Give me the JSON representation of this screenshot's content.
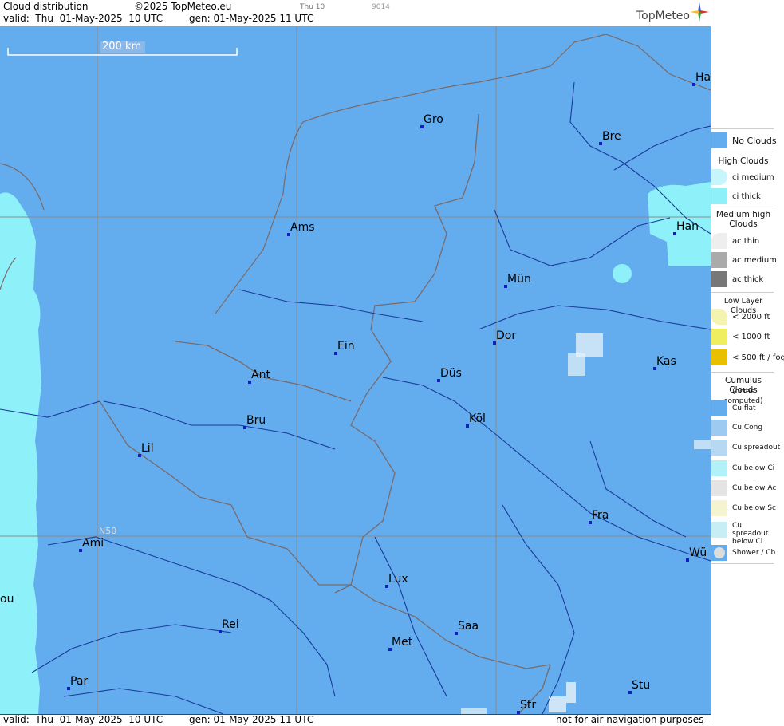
{
  "header": {
    "title": "Cloud distribution",
    "copyright": "©2025 TopMeteo.eu",
    "day_tag": "Thu 10",
    "code": "9014",
    "valid": "valid:  Thu  01-May-2025  10 UTC",
    "gen": "gen: 01-May-2025 11 UTC",
    "logo": "TopMeteo"
  },
  "footer": {
    "valid": "valid:  Thu  01-May-2025  10 UTC",
    "gen": "gen: 01-May-2025 11 UTC",
    "disclaimer": "not for air navigation purposes"
  },
  "map": {
    "scale_label": "200 km",
    "lat_label": "N50",
    "cities": [
      {
        "name": "Gro"
      },
      {
        "name": "Bre"
      },
      {
        "name": "Ha"
      },
      {
        "name": "Ams"
      },
      {
        "name": "Han"
      },
      {
        "name": "Mün"
      },
      {
        "name": "Dor"
      },
      {
        "name": "Ein"
      },
      {
        "name": "Ant"
      },
      {
        "name": "Düs"
      },
      {
        "name": "Kas"
      },
      {
        "name": "Köl"
      },
      {
        "name": "Bru"
      },
      {
        "name": "Lil"
      },
      {
        "name": "Fra"
      },
      {
        "name": "Ami"
      },
      {
        "name": "Wü"
      },
      {
        "name": "Lux"
      },
      {
        "name": "ou"
      },
      {
        "name": "Rei"
      },
      {
        "name": "Saa"
      },
      {
        "name": "Met"
      },
      {
        "name": "Par"
      },
      {
        "name": "Stu"
      },
      {
        "name": "Str"
      }
    ]
  },
  "legend": {
    "no_clouds": "No Clouds",
    "high_title": "High Clouds",
    "ci_medium": "ci medium",
    "ci_thick": "ci thick",
    "medium_title": "Medium high Clouds",
    "ac_thin": "ac thin",
    "ac_medium": "ac medium",
    "ac_thick": "ac thick",
    "low_title": "Low Layer Clouds",
    "lt2000": "< 2000 ft",
    "lt1000": "< 1000 ft",
    "lt500": "< 500 ft / fog",
    "cu_title": "Cumulus Clouds",
    "cu_sub": "(octas computed)",
    "cu_flat": "Cu flat",
    "cu_cong": "Cu Cong",
    "cu_spread": "Cu spreadout",
    "cu_below_ci": "Cu below Ci",
    "cu_below_ac": "Cu below Ac",
    "cu_below_sc": "Cu below Sc",
    "cu_spread_ci": "Cu spreadout below Ci",
    "shower": "Shower / Cb"
  },
  "colors": {
    "no_clouds": "#63acee",
    "ci": "#8ef0f8",
    "ac_medium": "#aaaaaa",
    "ac_thick": "#777777",
    "low_2000": "#f4f4b0",
    "low_1000": "#eeee60",
    "low_500": "#e8c000",
    "borders": "#7a6a6a",
    "rivers": "#1a3a9a"
  }
}
